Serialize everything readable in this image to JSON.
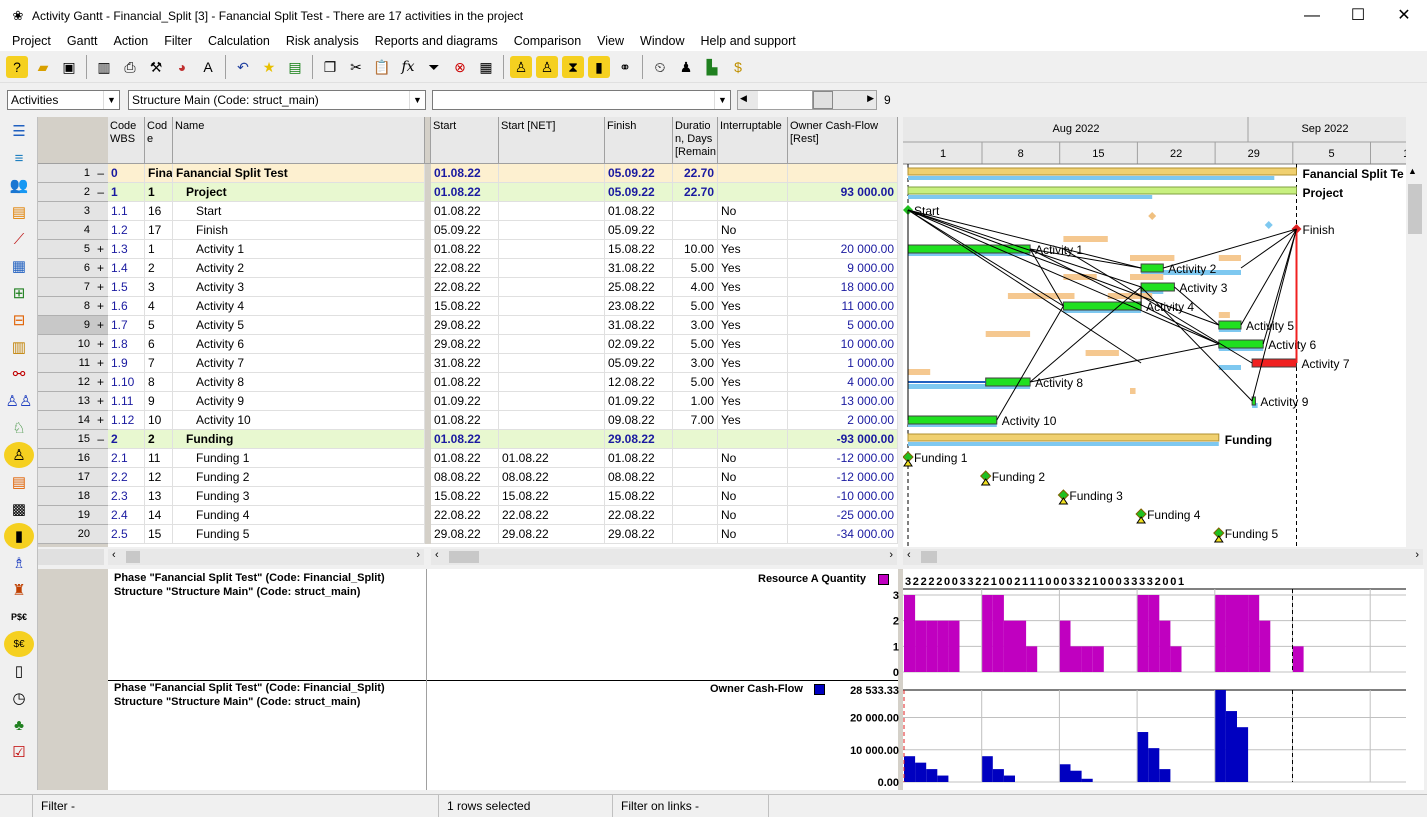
{
  "window": {
    "title": "Activity Gantt - Financial_Split [3] - Fanancial Split Test - There are 17 activities in the project",
    "minimize": "—",
    "maximize": "☐",
    "close": "✕"
  },
  "menu": [
    "Project",
    "Gantt",
    "Action",
    "Filter",
    "Calculation",
    "Risk analysis",
    "Reports and diagrams",
    "Comparison",
    "View",
    "Window",
    "Help and support"
  ],
  "selectors": {
    "view": "Activities",
    "structure": "Structure Main (Code: struct_main)",
    "empty": "",
    "zoom": "9"
  },
  "columns": [
    "Code WBS",
    "Cod e",
    "Name",
    "Start",
    "Start [NET]",
    "Finish",
    "Duratio n, Days [Remain",
    "Interruptable",
    "Owner Cash-Flow [Rest]"
  ],
  "timeline": {
    "months": [
      "Aug 2022",
      "Sep 2022"
    ],
    "days": [
      "1",
      "8",
      "15",
      "22",
      "29",
      "5",
      "12"
    ]
  },
  "rows": [
    {
      "n": "1",
      "pm": "–",
      "wbs": "0",
      "code": "Fina",
      "name": "Fanancial Split Test",
      "start": "01.08.22",
      "startnet": "",
      "finish": "05.09.22",
      "dur": "22.70",
      "intr": "",
      "cash": ""
    },
    {
      "n": "2",
      "pm": "–",
      "wbs": "1",
      "code": "1",
      "name": "Project",
      "start": "01.08.22",
      "startnet": "",
      "finish": "05.09.22",
      "dur": "22.70",
      "intr": "",
      "cash": "93 000.00"
    },
    {
      "n": "3",
      "pm": "",
      "wbs": "1.1",
      "code": "16",
      "name": "Start",
      "start": "01.08.22",
      "startnet": "",
      "finish": "01.08.22",
      "dur": "",
      "intr": "No",
      "cash": ""
    },
    {
      "n": "4",
      "pm": "",
      "wbs": "1.2",
      "code": "17",
      "name": "Finish",
      "start": "05.09.22",
      "startnet": "",
      "finish": "05.09.22",
      "dur": "",
      "intr": "No",
      "cash": ""
    },
    {
      "n": "5",
      "pm": "+",
      "wbs": "1.3",
      "code": "1",
      "name": "Activity 1",
      "start": "01.08.22",
      "startnet": "",
      "finish": "15.08.22",
      "dur": "10.00",
      "intr": "Yes",
      "cash": "20 000.00"
    },
    {
      "n": "6",
      "pm": "+",
      "wbs": "1.4",
      "code": "2",
      "name": "Activity 2",
      "start": "22.08.22",
      "startnet": "",
      "finish": "31.08.22",
      "dur": "5.00",
      "intr": "Yes",
      "cash": "9 000.00"
    },
    {
      "n": "7",
      "pm": "+",
      "wbs": "1.5",
      "code": "3",
      "name": "Activity 3",
      "start": "22.08.22",
      "startnet": "",
      "finish": "25.08.22",
      "dur": "4.00",
      "intr": "Yes",
      "cash": "18 000.00"
    },
    {
      "n": "8",
      "pm": "+",
      "wbs": "1.6",
      "code": "4",
      "name": "Activity 4",
      "start": "15.08.22",
      "startnet": "",
      "finish": "23.08.22",
      "dur": "5.00",
      "intr": "Yes",
      "cash": "11 000.00"
    },
    {
      "n": "9",
      "pm": "+",
      "wbs": "1.7",
      "code": "5",
      "name": "Activity 5",
      "start": "29.08.22",
      "startnet": "",
      "finish": "31.08.22",
      "dur": "3.00",
      "intr": "Yes",
      "cash": "5 000.00"
    },
    {
      "n": "10",
      "pm": "+",
      "wbs": "1.8",
      "code": "6",
      "name": "Activity 6",
      "start": "29.08.22",
      "startnet": "",
      "finish": "02.09.22",
      "dur": "5.00",
      "intr": "Yes",
      "cash": "10 000.00"
    },
    {
      "n": "11",
      "pm": "+",
      "wbs": "1.9",
      "code": "7",
      "name": "Activity 7",
      "start": "31.08.22",
      "startnet": "",
      "finish": "05.09.22",
      "dur": "3.00",
      "intr": "Yes",
      "cash": "1 000.00"
    },
    {
      "n": "12",
      "pm": "+",
      "wbs": "1.10",
      "code": "8",
      "name": "Activity 8",
      "start": "01.08.22",
      "startnet": "",
      "finish": "12.08.22",
      "dur": "5.00",
      "intr": "Yes",
      "cash": "4 000.00"
    },
    {
      "n": "13",
      "pm": "+",
      "wbs": "1.11",
      "code": "9",
      "name": "Activity 9",
      "start": "01.09.22",
      "startnet": "",
      "finish": "01.09.22",
      "dur": "1.00",
      "intr": "Yes",
      "cash": "13 000.00"
    },
    {
      "n": "14",
      "pm": "+",
      "wbs": "1.12",
      "code": "10",
      "name": "Activity 10",
      "start": "01.08.22",
      "startnet": "",
      "finish": "09.08.22",
      "dur": "7.00",
      "intr": "Yes",
      "cash": "2 000.00"
    },
    {
      "n": "15",
      "pm": "–",
      "wbs": "2",
      "code": "2",
      "name": "Funding",
      "start": "01.08.22",
      "startnet": "",
      "finish": "29.08.22",
      "dur": "",
      "intr": "",
      "cash": "-93 000.00"
    },
    {
      "n": "16",
      "pm": "",
      "wbs": "2.1",
      "code": "11",
      "name": "Funding 1",
      "start": "01.08.22",
      "startnet": "01.08.22",
      "finish": "01.08.22",
      "dur": "",
      "intr": "No",
      "cash": "-12 000.00"
    },
    {
      "n": "17",
      "pm": "",
      "wbs": "2.2",
      "code": "12",
      "name": "Funding 2",
      "start": "08.08.22",
      "startnet": "08.08.22",
      "finish": "08.08.22",
      "dur": "",
      "intr": "No",
      "cash": "-12 000.00"
    },
    {
      "n": "18",
      "pm": "",
      "wbs": "2.3",
      "code": "13",
      "name": "Funding 3",
      "start": "15.08.22",
      "startnet": "15.08.22",
      "finish": "15.08.22",
      "dur": "",
      "intr": "No",
      "cash": "-10 000.00"
    },
    {
      "n": "19",
      "pm": "",
      "wbs": "2.4",
      "code": "14",
      "name": "Funding 4",
      "start": "22.08.22",
      "startnet": "22.08.22",
      "finish": "22.08.22",
      "dur": "",
      "intr": "No",
      "cash": "-25 000.00"
    },
    {
      "n": "20",
      "pm": "",
      "wbs": "2.5",
      "code": "15",
      "name": "Funding 5",
      "start": "29.08.22",
      "startnet": "29.08.22",
      "finish": "29.08.22",
      "dur": "",
      "intr": "No",
      "cash": "-34 000.00"
    }
  ],
  "gantt_labels": [
    "Fanancial Split Te",
    "Project",
    "Start",
    "Finish",
    "Activity 1",
    "Activity 2",
    "Activity 3",
    "Activity 4",
    "Activity 5",
    "Activity 6",
    "Activity 7",
    "Activity 8",
    "Activity 9",
    "Activity 10",
    "Funding",
    "Funding 1",
    "Funding 2",
    "Funding 3",
    "Funding 4",
    "Funding 5"
  ],
  "bottom": {
    "phase1": "Phase \"Fanancial Split Test\" (Code: Financial_Split)",
    "struct1": "Structure \"Structure Main\" (Code: struct_main)",
    "phase2": "Phase \"Fanancial Split Test\" (Code: Financial_Split)",
    "struct2": "Structure \"Structure Main\" (Code: struct_main)",
    "resource_label": "Resource A Quantity",
    "cash_label": "Owner Cash-Flow",
    "resource_colors": "#c000c0",
    "cash_color": "#0000c0",
    "resource_ticks": [
      "3",
      "2",
      "1",
      "0"
    ],
    "cash_ticks": [
      "28 533.33",
      "20 000.00",
      "10 000.00",
      "0.00"
    ],
    "resource_values": "3 2 2 2 2 0 0 3 3 2 2 1 0 0 2 1 1 1 0 0 0 3 3 2 1 0 0 0 3 3 3 3 2 0 0 1"
  },
  "status": {
    "filter": "Filter -",
    "rows": "1 rows selected",
    "links": "Filter on links -"
  }
}
